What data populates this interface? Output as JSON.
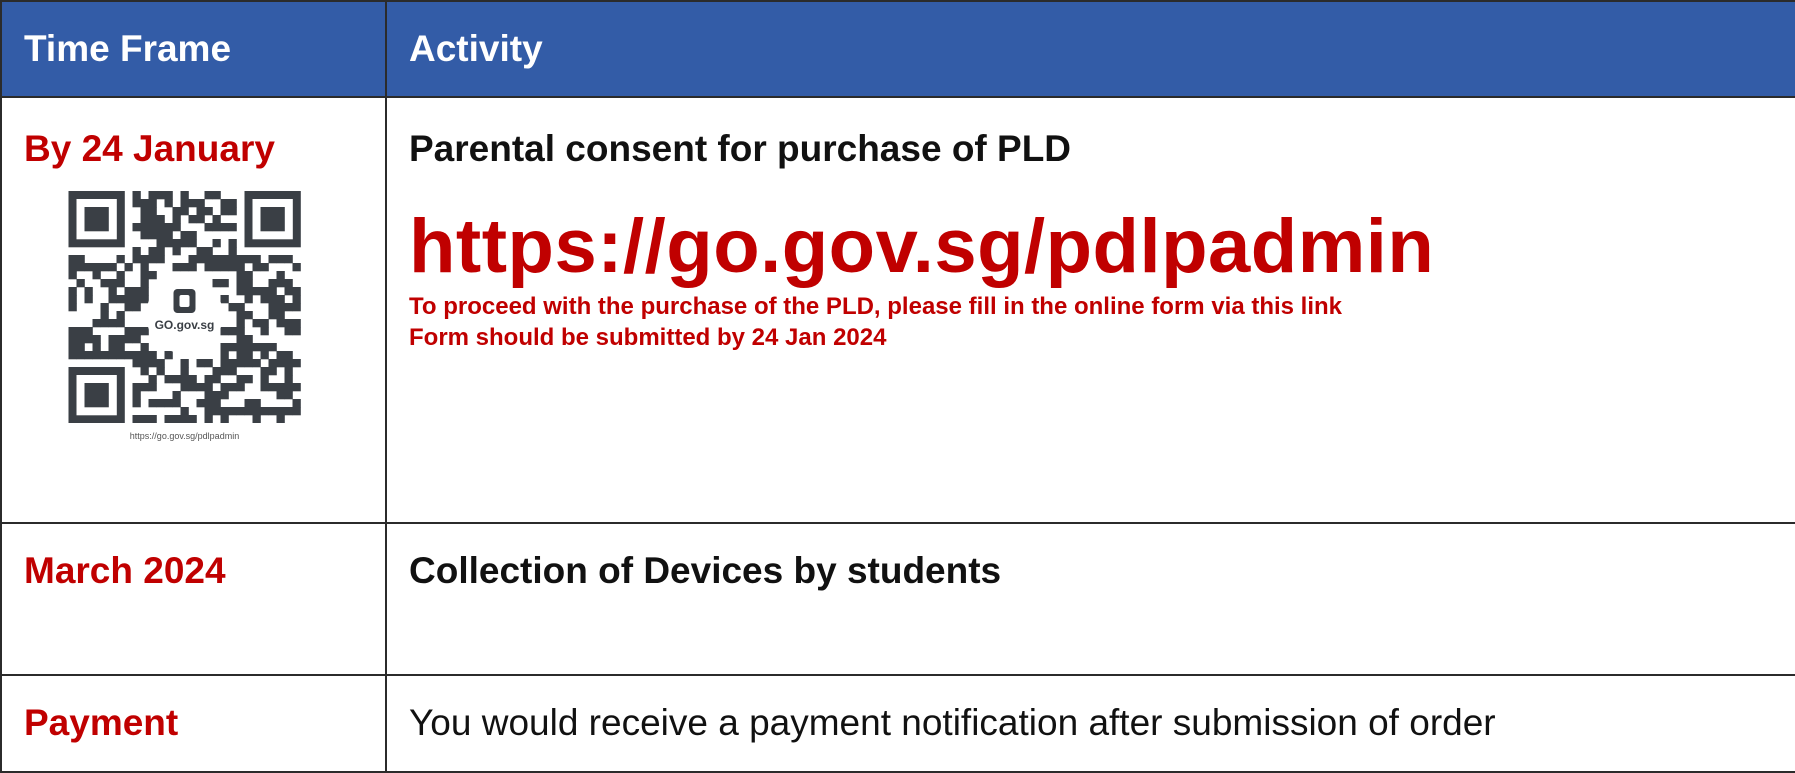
{
  "header": {
    "col_time_frame": "Time Frame",
    "col_activity": "Activity"
  },
  "rows": [
    {
      "time_frame": "By 24 January",
      "activity_title": "Parental consent for purchase of PLD",
      "url": "https://go.gov.sg/pdlpadmin",
      "note_line_1": "To proceed with the purchase of the PLD, please fill in the online form via this link",
      "note_line_2": "Form should be submitted by 24 Jan 2024",
      "qr": {
        "logo_text": "GO.gov.sg",
        "caption": "https://go.gov.sg/pdlpadmin"
      }
    },
    {
      "time_frame": "March 2024",
      "activity_title": "Collection of Devices by students"
    },
    {
      "time_frame": "Payment",
      "activity_text": "You would receive a payment notification after submission of order"
    }
  ],
  "colors": {
    "header_bg": "#335ca7",
    "accent_red": "#c00000",
    "border": "#2b2b2b"
  }
}
